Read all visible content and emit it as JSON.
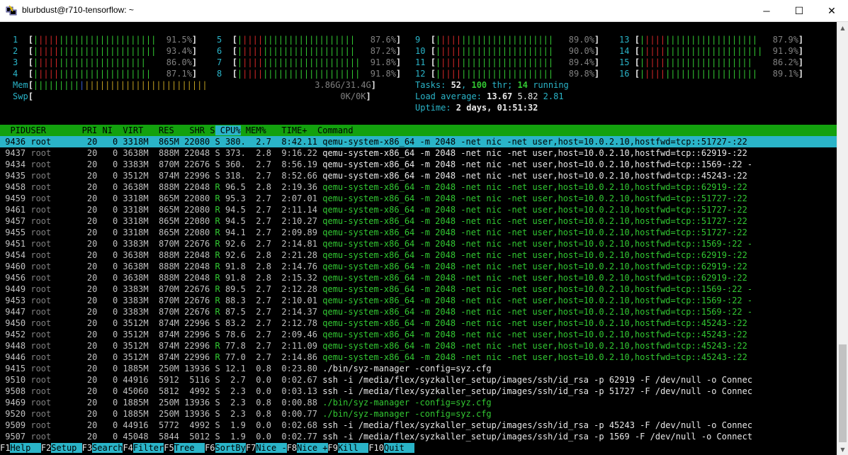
{
  "window": {
    "title": "blurbdust@r710-tensorflow: ~",
    "app_icon": "putty-icon",
    "minimize_icon": "─",
    "maximize_icon": "☐",
    "close_icon": "✕"
  },
  "colors": {
    "cyan": "#2ab4c8",
    "green": "#13a10e",
    "red": "#d42828",
    "grey": "#808080"
  },
  "cpu_meters": [
    {
      "id": "1",
      "value": "91.5%"
    },
    {
      "id": "2",
      "value": "93.4%"
    },
    {
      "id": "3",
      "value": "86.0%"
    },
    {
      "id": "4",
      "value": "87.1%"
    },
    {
      "id": "5",
      "value": "87.6%"
    },
    {
      "id": "6",
      "value": "87.2%"
    },
    {
      "id": "7",
      "value": "91.8%"
    },
    {
      "id": "8",
      "value": "91.8%"
    },
    {
      "id": "9",
      "value": "89.0%"
    },
    {
      "id": "10",
      "value": "90.0%"
    },
    {
      "id": "11",
      "value": "89.4%"
    },
    {
      "id": "12",
      "value": "89.8%"
    },
    {
      "id": "13",
      "value": "87.9%"
    },
    {
      "id": "14",
      "value": "91.9%"
    },
    {
      "id": "15",
      "value": "86.2%"
    },
    {
      "id": "16",
      "value": "89.1%"
    }
  ],
  "mem": {
    "label": "Mem",
    "value": "3.86G/31.4G"
  },
  "swp": {
    "label": "Swp",
    "value": "0K/0K"
  },
  "tasks": {
    "label": "Tasks: ",
    "tasks": "52",
    "sep1": ", ",
    "thr": "100",
    "thr_label": " thr; ",
    "running": "14",
    "running_label": " running"
  },
  "load": {
    "label": "Load average: ",
    "l1": "13.67",
    "l5": "5.82",
    "l15": "2.81"
  },
  "uptime": {
    "label": "Uptime: ",
    "value": "2 days, 01:51:32"
  },
  "columns": [
    "  PID",
    "USER     ",
    "  PRI",
    " NI",
    "  VIRT",
    "   RES",
    "   SHR",
    " S",
    " CPU%",
    " MEM%",
    "   TIME+ ",
    " Command"
  ],
  "processes": [
    {
      "pid": "9436",
      "user": "root",
      "pri": "20",
      "ni": "0",
      "virt": "3318M",
      "res": "865M",
      "shr": "22080",
      "s": "S",
      "cpu": "380.",
      "mem": "2.7",
      "time": "8:42.11",
      "cmd": "qemu-system-x86_64 -m 2048 -net nic -net user,host=10.0.2.10,hostfwd=tcp::51727-:22",
      "selected": true
    },
    {
      "pid": "9437",
      "user": "root",
      "pri": "20",
      "ni": "0",
      "virt": "3638M",
      "res": "888M",
      "shr": "22048",
      "s": "S",
      "cpu": "373.",
      "mem": "2.8",
      "time": "9:16.22",
      "cmd": "qemu-system-x86_64 -m 2048 -net nic -net user,host=10.0.2.10,hostfwd=tcp::62919-:22"
    },
    {
      "pid": "9434",
      "user": "root",
      "pri": "20",
      "ni": "0",
      "virt": "3383M",
      "res": "870M",
      "shr": "22676",
      "s": "S",
      "cpu": "360.",
      "mem": "2.7",
      "time": "8:56.19",
      "cmd": "qemu-system-x86_64 -m 2048 -net nic -net user,host=10.0.2.10,hostfwd=tcp::1569-:22 -"
    },
    {
      "pid": "9435",
      "user": "root",
      "pri": "20",
      "ni": "0",
      "virt": "3512M",
      "res": "874M",
      "shr": "22996",
      "s": "S",
      "cpu": "318.",
      "mem": "2.7",
      "time": "8:52.66",
      "cmd": "qemu-system-x86_64 -m 2048 -net nic -net user,host=10.0.2.10,hostfwd=tcp::45243-:22"
    },
    {
      "pid": "9458",
      "user": "root",
      "pri": "20",
      "ni": "0",
      "virt": "3638M",
      "res": "888M",
      "shr": "22048",
      "s": "R",
      "cpu": "96.5",
      "mem": "2.8",
      "time": "2:19.36",
      "cmd": "qemu-system-x86_64 -m 2048 -net nic -net user,host=10.0.2.10,hostfwd=tcp::62919-:22",
      "thread": true
    },
    {
      "pid": "9459",
      "user": "root",
      "pri": "20",
      "ni": "0",
      "virt": "3318M",
      "res": "865M",
      "shr": "22080",
      "s": "R",
      "cpu": "95.3",
      "mem": "2.7",
      "time": "2:07.01",
      "cmd": "qemu-system-x86_64 -m 2048 -net nic -net user,host=10.0.2.10,hostfwd=tcp::51727-:22",
      "thread": true
    },
    {
      "pid": "9461",
      "user": "root",
      "pri": "20",
      "ni": "0",
      "virt": "3318M",
      "res": "865M",
      "shr": "22080",
      "s": "R",
      "cpu": "94.5",
      "mem": "2.7",
      "time": "2:11.14",
      "cmd": "qemu-system-x86_64 -m 2048 -net nic -net user,host=10.0.2.10,hostfwd=tcp::51727-:22",
      "thread": true
    },
    {
      "pid": "9457",
      "user": "root",
      "pri": "20",
      "ni": "0",
      "virt": "3318M",
      "res": "865M",
      "shr": "22080",
      "s": "R",
      "cpu": "94.5",
      "mem": "2.7",
      "time": "2:10.27",
      "cmd": "qemu-system-x86_64 -m 2048 -net nic -net user,host=10.0.2.10,hostfwd=tcp::51727-:22",
      "thread": true
    },
    {
      "pid": "9455",
      "user": "root",
      "pri": "20",
      "ni": "0",
      "virt": "3318M",
      "res": "865M",
      "shr": "22080",
      "s": "R",
      "cpu": "94.1",
      "mem": "2.7",
      "time": "2:09.89",
      "cmd": "qemu-system-x86_64 -m 2048 -net nic -net user,host=10.0.2.10,hostfwd=tcp::51727-:22",
      "thread": true
    },
    {
      "pid": "9451",
      "user": "root",
      "pri": "20",
      "ni": "0",
      "virt": "3383M",
      "res": "870M",
      "shr": "22676",
      "s": "R",
      "cpu": "92.6",
      "mem": "2.7",
      "time": "2:14.81",
      "cmd": "qemu-system-x86_64 -m 2048 -net nic -net user,host=10.0.2.10,hostfwd=tcp::1569-:22 -",
      "thread": true
    },
    {
      "pid": "9454",
      "user": "root",
      "pri": "20",
      "ni": "0",
      "virt": "3638M",
      "res": "888M",
      "shr": "22048",
      "s": "R",
      "cpu": "92.6",
      "mem": "2.8",
      "time": "2:21.28",
      "cmd": "qemu-system-x86_64 -m 2048 -net nic -net user,host=10.0.2.10,hostfwd=tcp::62919-:22",
      "thread": true
    },
    {
      "pid": "9460",
      "user": "root",
      "pri": "20",
      "ni": "0",
      "virt": "3638M",
      "res": "888M",
      "shr": "22048",
      "s": "R",
      "cpu": "91.8",
      "mem": "2.8",
      "time": "2:14.76",
      "cmd": "qemu-system-x86_64 -m 2048 -net nic -net user,host=10.0.2.10,hostfwd=tcp::62919-:22",
      "thread": true
    },
    {
      "pid": "9456",
      "user": "root",
      "pri": "20",
      "ni": "0",
      "virt": "3638M",
      "res": "888M",
      "shr": "22048",
      "s": "R",
      "cpu": "91.8",
      "mem": "2.8",
      "time": "2:15.32",
      "cmd": "qemu-system-x86_64 -m 2048 -net nic -net user,host=10.0.2.10,hostfwd=tcp::62919-:22",
      "thread": true
    },
    {
      "pid": "9449",
      "user": "root",
      "pri": "20",
      "ni": "0",
      "virt": "3383M",
      "res": "870M",
      "shr": "22676",
      "s": "R",
      "cpu": "89.5",
      "mem": "2.7",
      "time": "2:12.28",
      "cmd": "qemu-system-x86_64 -m 2048 -net nic -net user,host=10.0.2.10,hostfwd=tcp::1569-:22 -",
      "thread": true
    },
    {
      "pid": "9453",
      "user": "root",
      "pri": "20",
      "ni": "0",
      "virt": "3383M",
      "res": "870M",
      "shr": "22676",
      "s": "R",
      "cpu": "88.3",
      "mem": "2.7",
      "time": "2:10.01",
      "cmd": "qemu-system-x86_64 -m 2048 -net nic -net user,host=10.0.2.10,hostfwd=tcp::1569-:22 -",
      "thread": true
    },
    {
      "pid": "9447",
      "user": "root",
      "pri": "20",
      "ni": "0",
      "virt": "3383M",
      "res": "870M",
      "shr": "22676",
      "s": "R",
      "cpu": "87.5",
      "mem": "2.7",
      "time": "2:14.37",
      "cmd": "qemu-system-x86_64 -m 2048 -net nic -net user,host=10.0.2.10,hostfwd=tcp::1569-:22 -",
      "thread": true
    },
    {
      "pid": "9450",
      "user": "root",
      "pri": "20",
      "ni": "0",
      "virt": "3512M",
      "res": "874M",
      "shr": "22996",
      "s": "S",
      "cpu": "83.2",
      "mem": "2.7",
      "time": "2:12.78",
      "cmd": "qemu-system-x86_64 -m 2048 -net nic -net user,host=10.0.2.10,hostfwd=tcp::45243-:22",
      "thread": true
    },
    {
      "pid": "9452",
      "user": "root",
      "pri": "20",
      "ni": "0",
      "virt": "3512M",
      "res": "874M",
      "shr": "22996",
      "s": "S",
      "cpu": "78.6",
      "mem": "2.7",
      "time": "2:09.46",
      "cmd": "qemu-system-x86_64 -m 2048 -net nic -net user,host=10.0.2.10,hostfwd=tcp::45243-:22",
      "thread": true
    },
    {
      "pid": "9448",
      "user": "root",
      "pri": "20",
      "ni": "0",
      "virt": "3512M",
      "res": "874M",
      "shr": "22996",
      "s": "R",
      "cpu": "77.8",
      "mem": "2.7",
      "time": "2:11.09",
      "cmd": "qemu-system-x86_64 -m 2048 -net nic -net user,host=10.0.2.10,hostfwd=tcp::45243-:22",
      "thread": true
    },
    {
      "pid": "9446",
      "user": "root",
      "pri": "20",
      "ni": "0",
      "virt": "3512M",
      "res": "874M",
      "shr": "22996",
      "s": "R",
      "cpu": "77.0",
      "mem": "2.7",
      "time": "2:14.86",
      "cmd": "qemu-system-x86_64 -m 2048 -net nic -net user,host=10.0.2.10,hostfwd=tcp::45243-:22",
      "thread": true
    },
    {
      "pid": "9415",
      "user": "root",
      "pri": "20",
      "ni": "0",
      "virt": "1885M",
      "res": "250M",
      "shr": "13936",
      "s": "S",
      "cpu": "12.1",
      "mem": "0.8",
      "time": "0:23.80",
      "cmd": "./bin/syz-manager -config=syz.cfg"
    },
    {
      "pid": "9510",
      "user": "root",
      "pri": "20",
      "ni": "0",
      "virt": "44916",
      "res": "5912",
      "shr": "5116",
      "s": "S",
      "cpu": "2.7",
      "mem": "0.0",
      "time": "0:02.67",
      "cmd": "ssh -i /media/flex/syzkaller_setup/images/ssh/id_rsa -p 62919 -F /dev/null -o Connec"
    },
    {
      "pid": "9508",
      "user": "root",
      "pri": "20",
      "ni": "0",
      "virt": "45060",
      "res": "5812",
      "shr": "4992",
      "s": "S",
      "cpu": "2.3",
      "mem": "0.0",
      "time": "0:03.13",
      "cmd": "ssh -i /media/flex/syzkaller_setup/images/ssh/id_rsa -p 51727 -F /dev/null -o Connec"
    },
    {
      "pid": "9469",
      "user": "root",
      "pri": "20",
      "ni": "0",
      "virt": "1885M",
      "res": "250M",
      "shr": "13936",
      "s": "S",
      "cpu": "2.3",
      "mem": "0.8",
      "time": "0:00.88",
      "cmd": "./bin/syz-manager -config=syz.cfg",
      "thread": true
    },
    {
      "pid": "9520",
      "user": "root",
      "pri": "20",
      "ni": "0",
      "virt": "1885M",
      "res": "250M",
      "shr": "13936",
      "s": "S",
      "cpu": "2.3",
      "mem": "0.8",
      "time": "0:00.77",
      "cmd": "./bin/syz-manager -config=syz.cfg",
      "thread": true
    },
    {
      "pid": "9509",
      "user": "root",
      "pri": "20",
      "ni": "0",
      "virt": "44916",
      "res": "5772",
      "shr": "4992",
      "s": "S",
      "cpu": "1.9",
      "mem": "0.0",
      "time": "0:02.68",
      "cmd": "ssh -i /media/flex/syzkaller_setup/images/ssh/id_rsa -p 45243 -F /dev/null -o Connec"
    },
    {
      "pid": "9507",
      "user": "root",
      "pri": "20",
      "ni": "0",
      "virt": "45048",
      "res": "5844",
      "shr": "5012",
      "s": "S",
      "cpu": "1.9",
      "mem": "0.0",
      "time": "0:02.77",
      "cmd": "ssh -i /media/flex/syzkaller_setup/images/ssh/id_rsa -p 1569 -F /dev/null -o Connect"
    }
  ],
  "function_keys": [
    {
      "key": "F1",
      "label": "Help  "
    },
    {
      "key": "F2",
      "label": "Setup "
    },
    {
      "key": "F3",
      "label": "Search"
    },
    {
      "key": "F4",
      "label": "Filter"
    },
    {
      "key": "F5",
      "label": "Tree  "
    },
    {
      "key": "F6",
      "label": "SortBy"
    },
    {
      "key": "F7",
      "label": "Nice -"
    },
    {
      "key": "F8",
      "label": "Nice +"
    },
    {
      "key": "F9",
      "label": "Kill  "
    },
    {
      "key": "F10",
      "label": "Quit  "
    }
  ]
}
